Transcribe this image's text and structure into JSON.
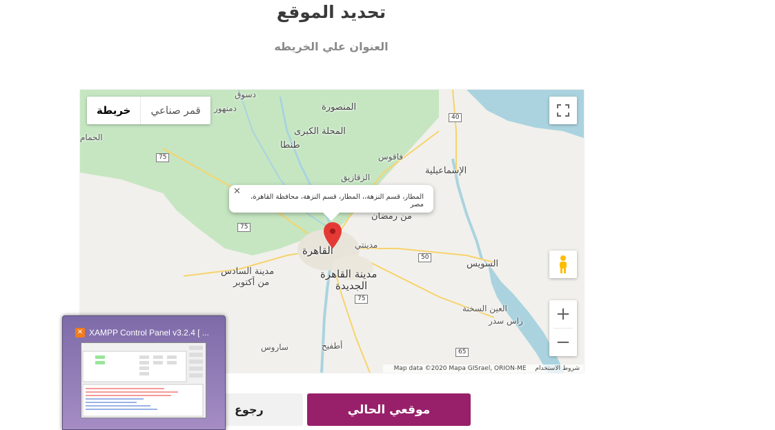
{
  "header": {
    "title": "تحديد الموقع",
    "subtitle": "العنوان علي الخريطه"
  },
  "map": {
    "type_buttons": {
      "map": "خريطة",
      "satellite": "قمر صناعي"
    },
    "info_window": "المطار، قسم النزهة،، المطار، قسم النزهة، محافظة القاهرة، مصر",
    "attribution": {
      "data": "Map data ©2020 Mapa GISrael, ORION-ME",
      "terms": "شروط الاستخدام"
    },
    "zoom": {
      "in": "+",
      "out": "−"
    },
    "labels": {
      "desouk": "دسوق",
      "damanhour": "دمنهور",
      "mansoura": "المنصورة",
      "mahalla": "المحلة الكبرى",
      "tanta": "طنطا",
      "faqous": "فاقوس",
      "zagazig": "الزقازيق",
      "ismailia": "الإسماعيلية",
      "ramadan": "من رمضان",
      "badr": "مدينتي",
      "cairo": "القاهرة",
      "new_cairo_1": "مدينة القاهرة",
      "new_cairo_2": "الجديدة",
      "sadat": "مدينة السادس",
      "october": "من أكتوبر",
      "suez": "السويس",
      "sokhna": "العين السخنة",
      "ras_sudr": "راس سدر",
      "atfih": "أطفيح",
      "tamaya": "ساروس",
      "hamam": "الحمام"
    },
    "shields": [
      "40",
      "75",
      "75",
      "50",
      "75",
      "65"
    ],
    "colors": {
      "land": "#f1f0ec",
      "green": "#c6e6c2",
      "water": "#aad3df",
      "road": "#f7d36b",
      "pin": "#e53935"
    }
  },
  "buttons": {
    "current_location": "موقعي الحالي",
    "back": "رجوع"
  },
  "taskbar_preview": {
    "title": "XAMPP Control Panel v3.2.4   [ ...",
    "icon": "xampp-icon"
  }
}
